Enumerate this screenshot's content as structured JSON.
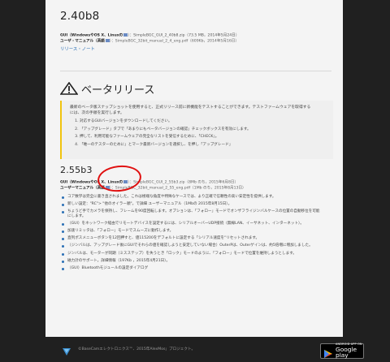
{
  "v240": {
    "title": "2.40b8",
    "gui_label": "GUI（WindowsやOS X、Linuxの",
    "gui_file": "）：SimpleBGC_GUI_2_40b8.zip（73.5 MB，2014年5月24日）",
    "manual_label": "ユーザ・マニュアル（英語",
    "manual_file": "）：SimpleBGC_32bit_manual_2_4_eng.pdf（609Kb，2014年5月16日）",
    "release_notes": "リリース・ノート"
  },
  "beta": {
    "title": "ベータリリース",
    "para": "最新のベータ版スナップショットを使用すると、正式リリース前に新機能をテストすることができます。テストファームウェアを取得するには、次の手順を実行します。",
    "steps": [
      "対応するGUIバージョンをダウンロードしてください。",
      "「アップグレード」タブで「あまりにもベータバージョンの確認」チェックボックスを有効にします。",
      "押して、利用可能なファームウェアの完全なリストを受信するために、「CHECK」。",
      "「唯一のテスターのために」とマーク最新バージョンを選択し、を押し「アップグレード」"
    ]
  },
  "v255": {
    "title": "2.55b3",
    "gui_label": "GUI（WindowsやOS X、Linuxの",
    "gui_file": "）：SimpleBGC_GUI_2_55b3.zip（8Mb のち，2015年6月8日）",
    "manual_label": "ユーザーマニュアル（英語",
    "manual_file": "）：SimpleBGC_32bit_manual_2_55_eng.pdf（1Mb のち，2015年8月13日）",
    "bullets": [
      "コア数学は完全に書き直されました。これは極端な角度や特殊なケースでは、より正確で信頼性の高い安定性を提供します。",
      "新しい設定：\"RC\"> \"他のオイラー順\"。で詳細 ユーザーマニュアル（1Mbの 2015年8月15日）。",
      "ちょうど手でカメラを保持し、フレームを90度回転します。オプションは、「フォロー」モードでオンザフライジンバルケースの位置の自動移位を可能にします。",
      "（GUI）をネットワーク経由でリモートデバイスを設定するには、シリアルオーバーUDP接続（無線LAN、イーサネット、インターネット）。",
      "加速リミッタは、「フォロー」モードでスムーズに動作します。",
      "直列ポスメニューボタンを12回押すと、値115200をデフォルトに設定する「シリアル速度を\"リセットされます。",
      "（ジンバルは、アップグレード後にGUIでそれらの値を確認しようと安定していない場合）OuterPは、Outerゲインは、約5倍増に増加しました。",
      "ジンバルは、モーターが同期（ミスステップ）を失うとき「ロック」モードのように、「フォロー」モードで位置を維持しようとします。",
      "磁力計のサポート。詳細情報（197Kb ，2015年4月21日）。",
      "（GUI）Bluetoothモジュールの設定ダイアログ"
    ]
  },
  "footer": {
    "text": "©BaseCamエレクトロニクス™、2015年AlexMos」プロジェクト。",
    "badge_small": "ANDROID APP ON",
    "badge_big": "Google play"
  },
  "colors": {
    "accent_link": "#2a6fb5",
    "warn_border": "#f1c40f",
    "annotation": "#e01010"
  }
}
